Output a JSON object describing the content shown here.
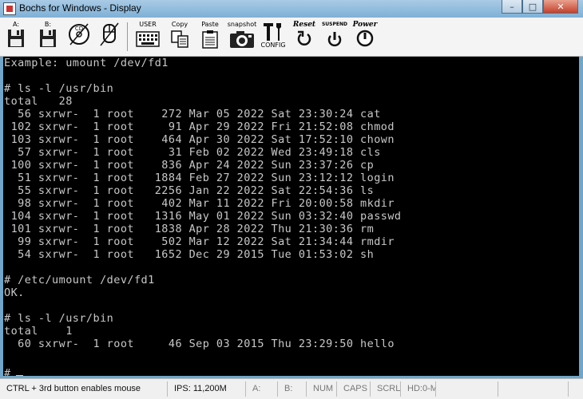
{
  "window": {
    "title": "Bochs for Windows - Display"
  },
  "toolbar": {
    "floppy_a": "A:",
    "floppy_b": "B:",
    "cdrom": "CD",
    "user": "USER",
    "copy": "Copy",
    "paste": "Paste",
    "snapshot": "snapshot",
    "config": "CONFIG",
    "reset": "Reset",
    "suspend": "SUSPEND",
    "power": "Power"
  },
  "terminal": {
    "lines": [
      "Example: umount /dev/fd1",
      "",
      "# ls -l /usr/bin",
      "total   28",
      "  56 sxrwr-  1 root    272 Mar 05 2022 Sat 23:30:24 cat",
      " 102 sxrwr-  1 root     91 Apr 29 2022 Fri 21:52:08 chmod",
      " 103 sxrwr-  1 root    464 Apr 30 2022 Sat 17:52:10 chown",
      "  57 sxrwr-  1 root     31 Feb 02 2022 Wed 23:49:18 cls",
      " 100 sxrwr-  1 root    836 Apr 24 2022 Sun 23:37:26 cp",
      "  51 sxrwr-  1 root   1884 Feb 27 2022 Sun 23:12:12 login",
      "  55 sxrwr-  1 root   2256 Jan 22 2022 Sat 22:54:36 ls",
      "  98 sxrwr-  1 root    402 Mar 11 2022 Fri 20:00:58 mkdir",
      " 104 sxrwr-  1 root   1316 May 01 2022 Sun 03:32:40 passwd",
      " 101 sxrwr-  1 root   1838 Apr 28 2022 Thu 21:30:36 rm",
      "  99 sxrwr-  1 root    502 Mar 12 2022 Sat 21:34:44 rmdir",
      "  54 sxrwr-  1 root   1652 Dec 29 2015 Tue 01:53:02 sh",
      "",
      "# /etc/umount /dev/fd1",
      "OK.",
      "",
      "# ls -l /usr/bin",
      "total    1",
      "  60 sxrwr-  1 root     46 Sep 03 2015 Thu 23:29:50 hello",
      ""
    ],
    "prompt": "#"
  },
  "statusbar": {
    "hint": "CTRL + 3rd button enables mouse",
    "ips": "IPS: 11,200M",
    "a": "A:",
    "b": "B:",
    "num": "NUM",
    "caps": "CAPS",
    "scrl": "SCRL",
    "hd": "HD:0-M"
  }
}
